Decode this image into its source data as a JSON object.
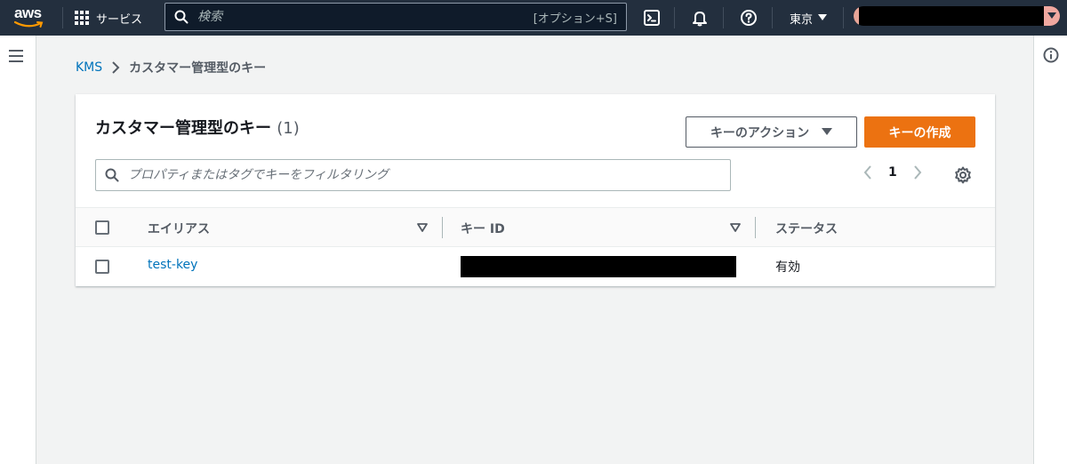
{
  "nav": {
    "logo_text": "aws",
    "services_label": "サービス",
    "search_placeholder": "検索",
    "search_shortcut": "[オプション+S]",
    "region_label": "東京",
    "icons": [
      "cloudshell-icon",
      "bell-icon",
      "help-icon"
    ]
  },
  "breadcrumb": {
    "root": "KMS",
    "current": "カスタマー管理型のキー"
  },
  "panel": {
    "title": "カスタマー管理型のキー",
    "count": "(1)",
    "actions_label": "キーのアクション",
    "create_label": "キーの作成",
    "filter_placeholder": "プロパティまたはタグでキーをフィルタリング",
    "page_number": "1"
  },
  "table": {
    "columns": [
      "エイリアス",
      "キー ID",
      "ステータス"
    ],
    "rows": [
      {
        "alias": "test-key",
        "status": "有効"
      }
    ]
  },
  "colors": {
    "nav_bg": "#232f3e",
    "primary_button": "#ec7211",
    "link": "#0073bb"
  }
}
